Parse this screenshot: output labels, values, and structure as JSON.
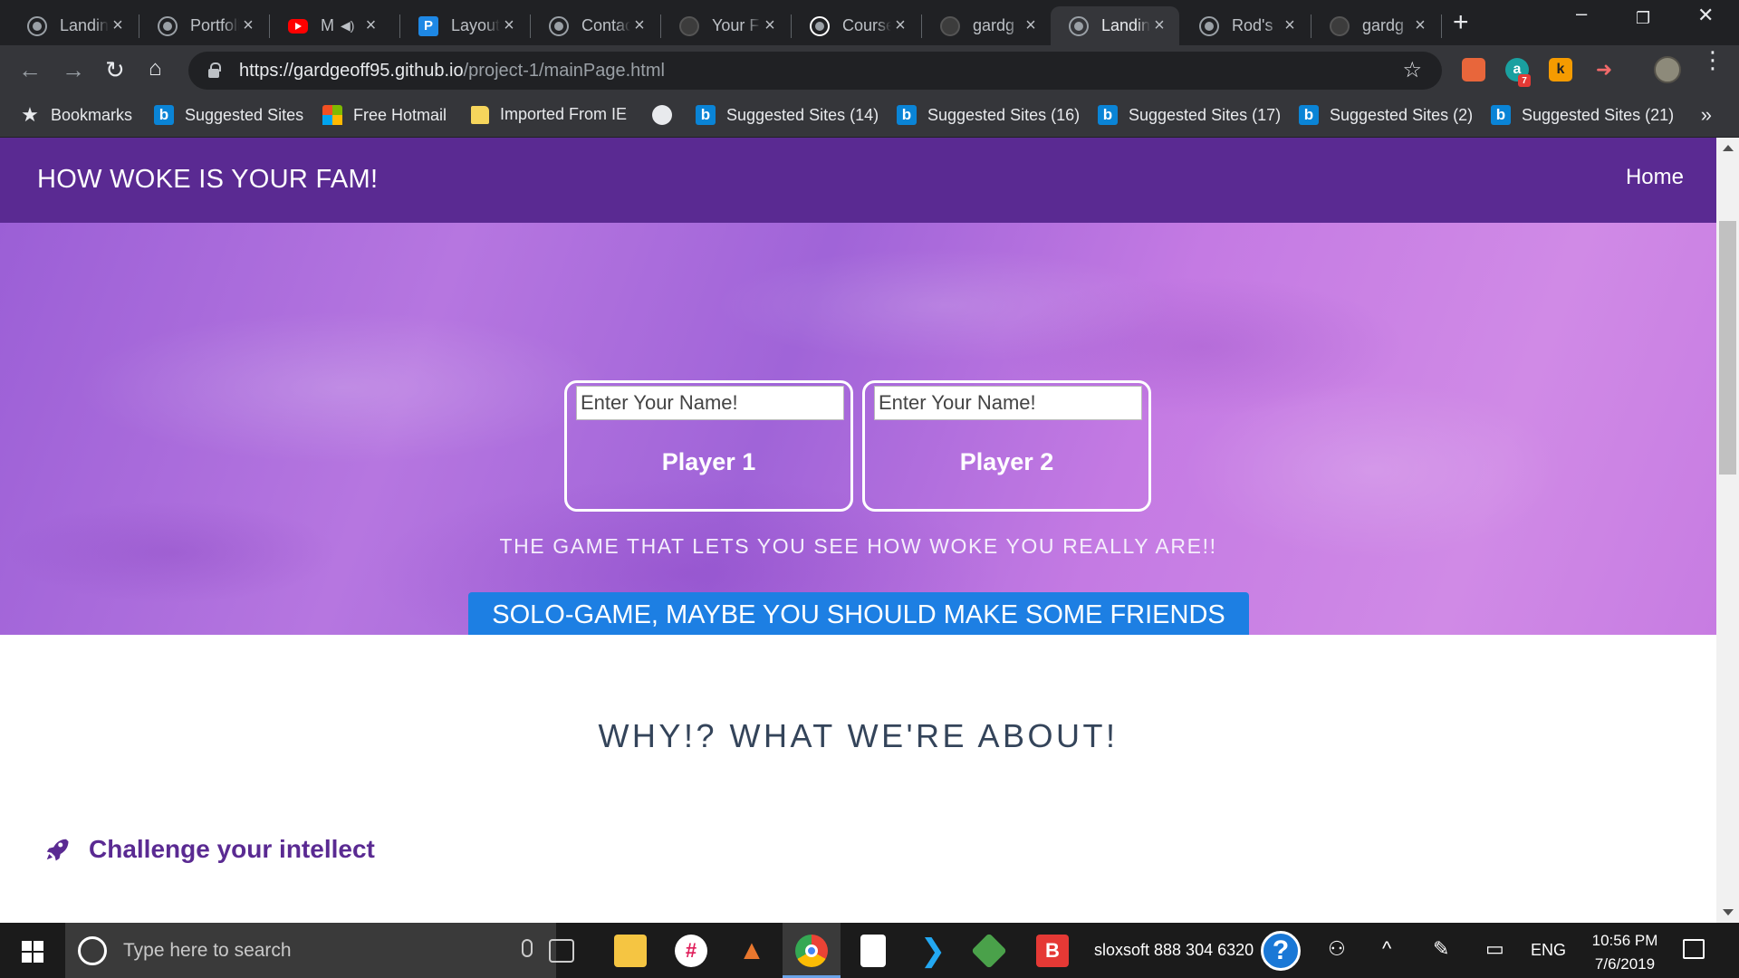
{
  "browser": {
    "tabs": [
      {
        "title": "Landing Page",
        "icon": "globe-icon"
      },
      {
        "title": "Portfolio",
        "icon": "globe-icon"
      },
      {
        "title": "M",
        "icon": "youtube-icon"
      },
      {
        "title": "Layout",
        "icon": "p-icon"
      },
      {
        "title": "Contact",
        "icon": "globe-icon"
      },
      {
        "title": "Your F",
        "icon": "github-icon"
      },
      {
        "title": "Course",
        "icon": "globe-icon"
      },
      {
        "title": "gardg",
        "icon": "github-icon"
      },
      {
        "title": "Landing",
        "icon": "globe-icon"
      },
      {
        "title": "Rod's",
        "icon": "globe-icon"
      },
      {
        "title": "gardg",
        "icon": "github-icon"
      }
    ],
    "url_host": "https://gardgeoff95.github.io",
    "url_path": "/project-1/mainPage.html",
    "bookmarks": [
      "Bookmarks",
      "Suggested Sites",
      "Free Hotmail",
      "Imported From IE",
      "Suggested Sites (14)",
      "Suggested Sites (16)",
      "Suggested Sites (17)",
      "Suggested Sites (2)",
      "Suggested Sites (21)"
    ],
    "extension_badge": "7"
  },
  "page": {
    "brand": "HOW WOKE IS YOUR FAM!",
    "nav_home": "Home",
    "player1_placeholder": "Enter Your Name!",
    "player2_placeholder": "Enter Your Name!",
    "player1_label": "Player 1",
    "player2_label": "Player 2",
    "tagline": "THE GAME THAT LETS YOU SEE HOW WOKE YOU REALLY ARE!!",
    "solo_button": "SOLO-GAME, MAYBE YOU SHOULD MAKE SOME FRIENDS",
    "section_title": "WHY!? WHAT WE'RE ABOUT!",
    "feature_1": "Challenge your intellect",
    "colors": {
      "navbar": "#5a2a92",
      "solo_button": "#1d7fe3",
      "feature_text": "#5a2a92"
    }
  },
  "taskbar": {
    "search_placeholder": "Type here to search",
    "tray_label": "sloxsoft 888 304 6320",
    "language": "ENG",
    "time": "10:56 PM",
    "date": "7/6/2019"
  }
}
